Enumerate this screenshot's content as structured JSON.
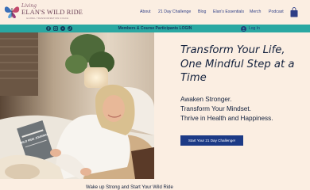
{
  "brand": {
    "script_line": "Living",
    "title": "ELAN'S WILD RIDE",
    "tagline": "GLOBAL TRANSFORMATION COACH",
    "logo_icon": "butterfly-icon"
  },
  "nav": {
    "items": [
      {
        "label": "About"
      },
      {
        "label": "21 Day Challenge"
      },
      {
        "label": "Blog"
      },
      {
        "label": "Elan's Essentials"
      },
      {
        "label": "Merch"
      },
      {
        "label": "Podcast"
      }
    ],
    "cart_icon": "shopping-bag-icon"
  },
  "topbar": {
    "social_icons": [
      "facebook-icon",
      "instagram-icon",
      "youtube-icon",
      "tiktok-icon"
    ],
    "members_link": "Members & Course Participants LOGIN",
    "login_label": "Log In",
    "login_icon": "user-avatar-icon"
  },
  "hero": {
    "headline": "Transform Your Life, One Mindful Step at a Time",
    "tagline_lines": [
      "Awaken Stronger.",
      "Transform Your Mindset.",
      "Thrive in Health and Happiness."
    ],
    "cta_label": "Start Your 21 Day Challenge!",
    "book_title": "WILD RIDE JOURNAL"
  },
  "footer_peek": {
    "text": "Wake up Strong and Start Your Wild Ride"
  },
  "colors": {
    "background": "#fbeee2",
    "teal_bar": "#2aa8a2",
    "nav_text": "#2e3e86",
    "cta_bg": "#1c3a86",
    "headline": "#12203c"
  }
}
